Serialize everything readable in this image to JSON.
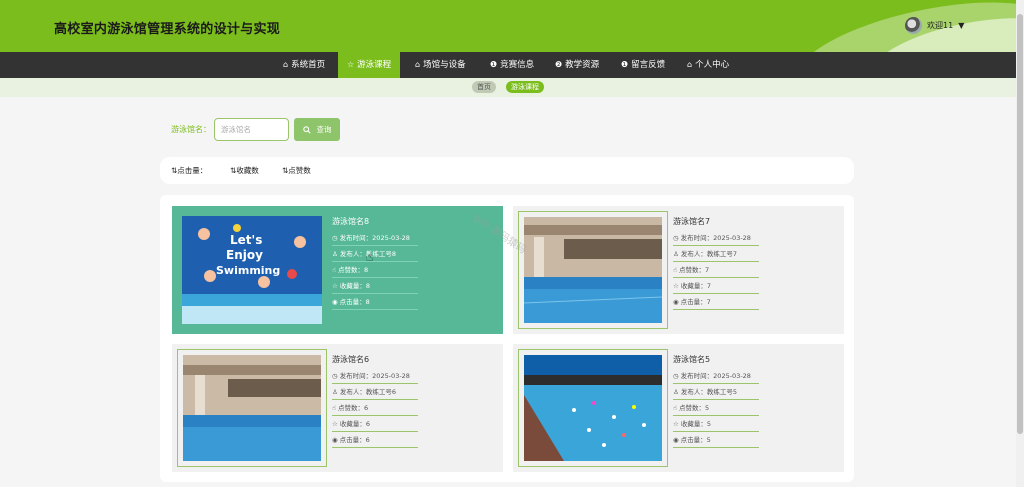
{
  "app": {
    "title": "高校室内游泳馆管理系统的设计与实现"
  },
  "user": {
    "greeting": "欢迎11",
    "caret_icon": "▼"
  },
  "nav": {
    "items": [
      {
        "label": "系统首页",
        "icon": "⌂",
        "active": false
      },
      {
        "label": "游泳课程",
        "icon": "☆",
        "active": true
      },
      {
        "label": "场馆与设备",
        "icon": "⌂",
        "active": false
      },
      {
        "label": "竞赛信息",
        "icon": "❶",
        "active": false
      },
      {
        "label": "教学资源",
        "icon": "❷",
        "active": false
      },
      {
        "label": "留言反馈",
        "icon": "❶",
        "active": false
      },
      {
        "label": "个人中心",
        "icon": "⌂",
        "active": false
      }
    ]
  },
  "breadcrumb": {
    "home": "首页",
    "current": "游泳课程"
  },
  "search": {
    "label": "游泳馆名：",
    "placeholder": "游泳馆名",
    "value": "",
    "button_label": "查询",
    "button_icon": "search-icon"
  },
  "sort": {
    "items": [
      "点击量：",
      "收藏数",
      "点赞数"
    ]
  },
  "cards": [
    {
      "name": "游泳馆名8",
      "publish_time": "发布时间：2025-03-28",
      "publisher": "发布人：教练工号8",
      "likes": "点赞数：8",
      "favorites": "收藏量：8",
      "clicks": "点击量：8",
      "image": "lets-enjoy-swimming-poster",
      "active": true
    },
    {
      "name": "游泳馆名7",
      "publish_time": "发布时间：2025-03-28",
      "publisher": "发布人：教练工号7",
      "likes": "点赞数：7",
      "favorites": "收藏量：7",
      "clicks": "点击量：7",
      "image": "indoor-pool-photo",
      "active": false
    },
    {
      "name": "游泳馆名6",
      "publish_time": "发布时间：2025-03-28",
      "publisher": "发布人：教练工号6",
      "likes": "点赞数：6",
      "favorites": "收藏量：6",
      "clicks": "点击量：6",
      "image": "indoor-pool-photo",
      "active": false
    },
    {
      "name": "游泳馆名5",
      "publish_time": "发布时间：2025-03-28",
      "publisher": "发布人：教练工号5",
      "likes": "点赞数：5",
      "favorites": "收藏量：5",
      "clicks": "点击量：5",
      "image": "crowded-pool-photo",
      "active": false
    }
  ],
  "watermark": "gzh 源码猿码",
  "colors": {
    "brand": "#7cbd1e",
    "nav_bg": "#333333",
    "active_card": "#56b896",
    "card_bg": "#f1f1f1"
  }
}
